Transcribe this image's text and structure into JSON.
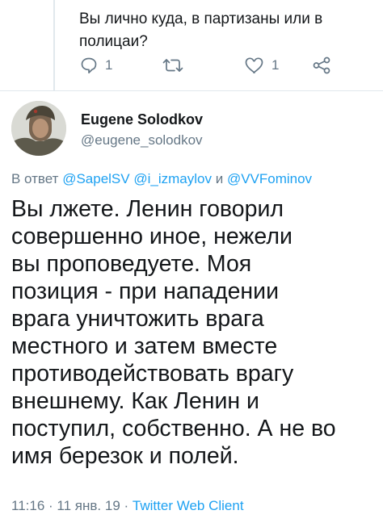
{
  "previous_tweet": {
    "text": "Вы лично куда, в партизаны или в полицаи?",
    "actions": {
      "reply_count": "1",
      "retweet_count": "",
      "like_count": "1",
      "reply_icon": "comment-icon",
      "retweet_icon": "retweet-icon",
      "like_icon": "heart-icon",
      "share_icon": "share-icon"
    }
  },
  "tweet": {
    "author": {
      "display_name": "Eugene Solodkov",
      "handle": "@eugene_solodkov"
    },
    "reply_to": {
      "prefix": "В ответ",
      "users": [
        "@SapelSV",
        "@i_izmaylov",
        "@VVFominov"
      ],
      "separator": "и"
    },
    "text": "Вы лжете. Ленин говорил\nсовершенно иное, нежели\nвы проповедуете. Моя\nпозиция - при нападении\nврага уничтожить врага\nместного и затем вместе\nпротиводействовать врагу\nвнешнему. Как Ленин и\nпоступил, собственно. А не во\nимя березок и полей.",
    "time": "11:16",
    "date": "11 янв. 19",
    "source": "Twitter Web Client",
    "dot": "·"
  },
  "colors": {
    "link": "#1da1f2",
    "muted": "#657786",
    "text": "#14171a",
    "divider": "#e1e8ed"
  }
}
